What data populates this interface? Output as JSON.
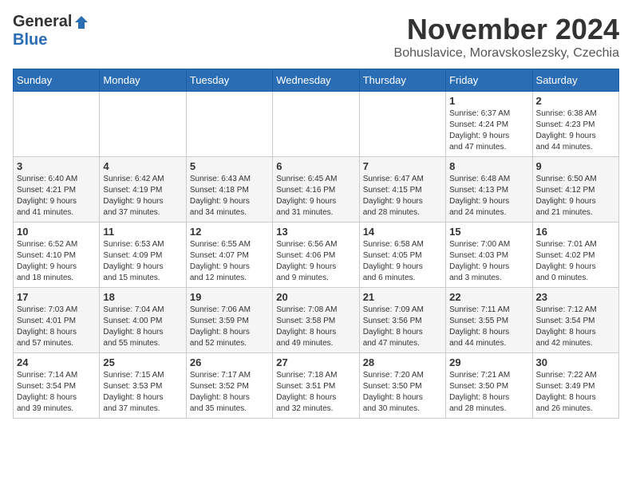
{
  "logo": {
    "general": "General",
    "blue": "Blue"
  },
  "title": "November 2024",
  "location": "Bohuslavice, Moravskoslezsky, Czechia",
  "days_header": [
    "Sunday",
    "Monday",
    "Tuesday",
    "Wednesday",
    "Thursday",
    "Friday",
    "Saturday"
  ],
  "weeks": [
    [
      {
        "day": "",
        "info": ""
      },
      {
        "day": "",
        "info": ""
      },
      {
        "day": "",
        "info": ""
      },
      {
        "day": "",
        "info": ""
      },
      {
        "day": "",
        "info": ""
      },
      {
        "day": "1",
        "info": "Sunrise: 6:37 AM\nSunset: 4:24 PM\nDaylight: 9 hours\nand 47 minutes."
      },
      {
        "day": "2",
        "info": "Sunrise: 6:38 AM\nSunset: 4:23 PM\nDaylight: 9 hours\nand 44 minutes."
      }
    ],
    [
      {
        "day": "3",
        "info": "Sunrise: 6:40 AM\nSunset: 4:21 PM\nDaylight: 9 hours\nand 41 minutes."
      },
      {
        "day": "4",
        "info": "Sunrise: 6:42 AM\nSunset: 4:19 PM\nDaylight: 9 hours\nand 37 minutes."
      },
      {
        "day": "5",
        "info": "Sunrise: 6:43 AM\nSunset: 4:18 PM\nDaylight: 9 hours\nand 34 minutes."
      },
      {
        "day": "6",
        "info": "Sunrise: 6:45 AM\nSunset: 4:16 PM\nDaylight: 9 hours\nand 31 minutes."
      },
      {
        "day": "7",
        "info": "Sunrise: 6:47 AM\nSunset: 4:15 PM\nDaylight: 9 hours\nand 28 minutes."
      },
      {
        "day": "8",
        "info": "Sunrise: 6:48 AM\nSunset: 4:13 PM\nDaylight: 9 hours\nand 24 minutes."
      },
      {
        "day": "9",
        "info": "Sunrise: 6:50 AM\nSunset: 4:12 PM\nDaylight: 9 hours\nand 21 minutes."
      }
    ],
    [
      {
        "day": "10",
        "info": "Sunrise: 6:52 AM\nSunset: 4:10 PM\nDaylight: 9 hours\nand 18 minutes."
      },
      {
        "day": "11",
        "info": "Sunrise: 6:53 AM\nSunset: 4:09 PM\nDaylight: 9 hours\nand 15 minutes."
      },
      {
        "day": "12",
        "info": "Sunrise: 6:55 AM\nSunset: 4:07 PM\nDaylight: 9 hours\nand 12 minutes."
      },
      {
        "day": "13",
        "info": "Sunrise: 6:56 AM\nSunset: 4:06 PM\nDaylight: 9 hours\nand 9 minutes."
      },
      {
        "day": "14",
        "info": "Sunrise: 6:58 AM\nSunset: 4:05 PM\nDaylight: 9 hours\nand 6 minutes."
      },
      {
        "day": "15",
        "info": "Sunrise: 7:00 AM\nSunset: 4:03 PM\nDaylight: 9 hours\nand 3 minutes."
      },
      {
        "day": "16",
        "info": "Sunrise: 7:01 AM\nSunset: 4:02 PM\nDaylight: 9 hours\nand 0 minutes."
      }
    ],
    [
      {
        "day": "17",
        "info": "Sunrise: 7:03 AM\nSunset: 4:01 PM\nDaylight: 8 hours\nand 57 minutes."
      },
      {
        "day": "18",
        "info": "Sunrise: 7:04 AM\nSunset: 4:00 PM\nDaylight: 8 hours\nand 55 minutes."
      },
      {
        "day": "19",
        "info": "Sunrise: 7:06 AM\nSunset: 3:59 PM\nDaylight: 8 hours\nand 52 minutes."
      },
      {
        "day": "20",
        "info": "Sunrise: 7:08 AM\nSunset: 3:58 PM\nDaylight: 8 hours\nand 49 minutes."
      },
      {
        "day": "21",
        "info": "Sunrise: 7:09 AM\nSunset: 3:56 PM\nDaylight: 8 hours\nand 47 minutes."
      },
      {
        "day": "22",
        "info": "Sunrise: 7:11 AM\nSunset: 3:55 PM\nDaylight: 8 hours\nand 44 minutes."
      },
      {
        "day": "23",
        "info": "Sunrise: 7:12 AM\nSunset: 3:54 PM\nDaylight: 8 hours\nand 42 minutes."
      }
    ],
    [
      {
        "day": "24",
        "info": "Sunrise: 7:14 AM\nSunset: 3:54 PM\nDaylight: 8 hours\nand 39 minutes."
      },
      {
        "day": "25",
        "info": "Sunrise: 7:15 AM\nSunset: 3:53 PM\nDaylight: 8 hours\nand 37 minutes."
      },
      {
        "day": "26",
        "info": "Sunrise: 7:17 AM\nSunset: 3:52 PM\nDaylight: 8 hours\nand 35 minutes."
      },
      {
        "day": "27",
        "info": "Sunrise: 7:18 AM\nSunset: 3:51 PM\nDaylight: 8 hours\nand 32 minutes."
      },
      {
        "day": "28",
        "info": "Sunrise: 7:20 AM\nSunset: 3:50 PM\nDaylight: 8 hours\nand 30 minutes."
      },
      {
        "day": "29",
        "info": "Sunrise: 7:21 AM\nSunset: 3:50 PM\nDaylight: 8 hours\nand 28 minutes."
      },
      {
        "day": "30",
        "info": "Sunrise: 7:22 AM\nSunset: 3:49 PM\nDaylight: 8 hours\nand 26 minutes."
      }
    ]
  ]
}
